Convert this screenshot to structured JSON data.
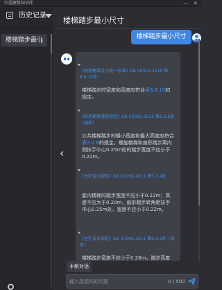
{
  "window": {
    "title": "中望建筑知识库",
    "minimize": "—",
    "close": "✕"
  },
  "sidebar": {
    "header_label": "历史记录",
    "items": [
      {
        "label": "楼梯踏步最小"
      }
    ]
  },
  "main": {
    "title": "楼梯踏步最小尺寸",
    "user_message": "楼梯踏步最小尺寸",
    "collapse_glyph": "‹",
    "answer": {
      "refs": [
        {
          "name": "《民用建筑设计统一标准》",
          "section": "GB 50352-2019 第6.8.10条"
        },
        {
          "name": "《民用建筑通用规范》",
          "section": "GB 55031-2022 第2.2.6条（强条）"
        },
        {
          "name": "《住宅设计规范》",
          "section": "GB 50096-2011 第5.7.4条"
        },
        {
          "name": "《住宅设计规范》",
          "section": "GB 50096-2011 第6.3.2条（强条）"
        }
      ],
      "p1": {
        "text": "楼梯踏步的宽度和高度应符合",
        "highlight": "表6.8.10",
        "after": "的规定。"
      },
      "p2": {
        "text": "公共楼梯踏步的最小宽度和最大高度应符合",
        "highlight": "表2.2.6",
        "after": "的规定。螺旋楼梯和扇形踏步离内侧扶手中心0.25m处的踏步宽度不应小于0.22m。"
      },
      "p3": {
        "text": "套内楼梯的踏步宽度不应小于0.22m；高度不应大于0.20m，扇形踏步转角距扶手中心0.25m处，宽度不应小于0.22m。"
      },
      "p4": {
        "text": "楼梯踏步宽度不应小于0.26m，踏步高度"
      }
    },
    "new_chat_label": "新对话",
    "new_chat_plus": "+",
    "input": {
      "placeholder": "输入您想问的问题",
      "counter": "0 / 500"
    }
  },
  "colors": {
    "accent": "#3f87e6",
    "background": "#2b2d33",
    "sidebar": "#25272c",
    "bubble": "#3e4148"
  }
}
